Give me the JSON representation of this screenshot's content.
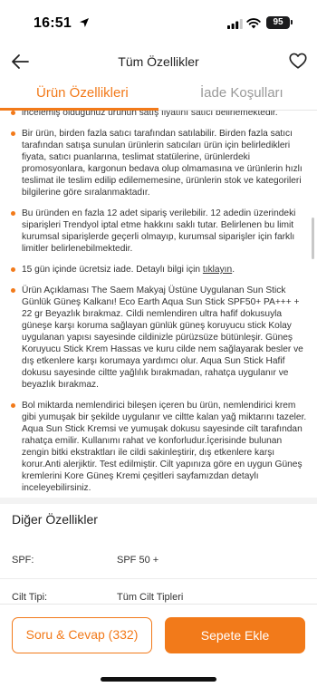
{
  "status_bar": {
    "time": "16:51",
    "battery": "95"
  },
  "header": {
    "title": "Tüm Özellikler"
  },
  "tabs": [
    {
      "label": "Ürün Özellikleri"
    },
    {
      "label": "İade Koşulları"
    }
  ],
  "bullets": [
    {
      "text": "incelemiş olduğunuz ürünün satış fiyatını satıcı belirlemektedir."
    },
    {
      "text": "Bir ürün, birden fazla satıcı tarafından satılabilir. Birden fazla satıcı tarafından satışa sunulan ürünlerin satıcıları ürün için belirledikleri fiyata, satıcı puanlarına, teslimat statülerine, ürünlerdeki promosyonlara, kargonun bedava olup olmamasına ve ürünlerin hızlı teslimat ile teslim edilip edilememesine, ürünlerin stok ve kategorileri bilgilerine göre sıralanmaktadır."
    },
    {
      "text": "Bu üründen en fazla 12 adet sipariş verilebilir. 12 adedin üzerindeki siparişleri Trendyol iptal etme hakkını saklı tutar. Belirlenen bu limit kurumsal siparişlerde geçerli olmayıp, kurumsal siparişler için farklı limitler belirlenebilmektedir."
    },
    {
      "text_before": "15 gün içinde ücretsiz iade. Detaylı bilgi için ",
      "link": "tıklayın",
      "text_after": "."
    },
    {
      "text": "Ürün Açıklaması The Saem Makyaj Üstüne Uygulanan Sun Stick Günlük Güneş Kalkanı! Eco Earth Aqua Sun Stick SPF50+ PA+++ + 22 gr Beyazlık bırakmaz. Cildi nemlendiren ultra hafif dokusuyla güneşe karşı koruma sağlayan günlük güneş koruyucu stick Kolay uygulanan yapısı sayesinde cildinizle pürüzsüze bütünleşir. Güneş Koruyucu Stick Krem Hassas ve kuru cilde nem sağlayarak besler ve dış etkenlere karşı korumaya yardımcı olur. Aqua Sun Stick Hafif dokusu sayesinde ciltte yağlılık bırakmadan, rahatça uygulanır ve beyazlık bırakmaz."
    },
    {
      "text": "Bol miktarda nemlendirici bileşen içeren bu ürün, nemlendirici krem gibi yumuşak bir şekilde uygulanır ve ciltte kalan yağ miktarını tazeler. Aqua Sun Stick Kremsi ve yumuşak dokusu sayesinde cilt tarafından rahatça emilir. Kullanımı rahat ve konforludur.İçerisinde bulunan zengin bitki ekstraktları ile cildi sakinleştirir, dış etkenlere karşı korur.Anti alerjiktir. Test edilmiştir. Cilt yapınıza göre en uygun Güneş kremlerini Kore Güneş Kremi çeşitleri sayfamızdan detaylı inceleyebilirsiniz."
    }
  ],
  "other_features": {
    "title": "Diğer Özellikler",
    "rows": [
      {
        "label": "SPF:",
        "value": "SPF 50 +"
      },
      {
        "label": "Cilt Tipi:",
        "value": "Tüm Cilt Tipleri"
      }
    ]
  },
  "bottom_bar": {
    "qa_label": "Soru & Cevap (332)",
    "cart_label": "Sepete Ekle"
  },
  "colors": {
    "accent": "#f27a1a",
    "text": "#333333",
    "muted": "#999999"
  },
  "icons": [
    "location-arrow-icon",
    "signal-icon",
    "wifi-icon",
    "back-arrow-icon",
    "heart-icon"
  ]
}
